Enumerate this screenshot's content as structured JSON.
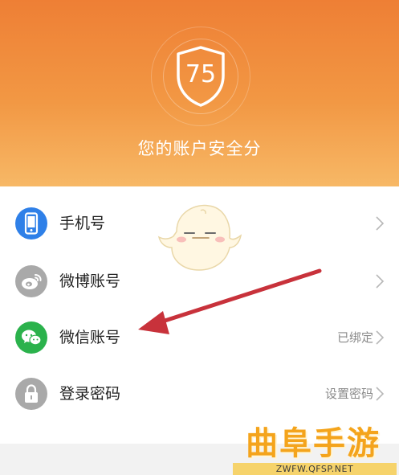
{
  "header": {
    "score": "75",
    "title": "您的账户安全分"
  },
  "accounts": [
    {
      "label": "手机号",
      "value": "",
      "icon": "phone-icon",
      "icon_color": "#2f80e8"
    },
    {
      "label": "微博账号",
      "value": "",
      "icon": "weibo-icon",
      "icon_color": "#a9a9a9"
    },
    {
      "label": "微信账号",
      "value": "已绑定",
      "icon": "wechat-icon",
      "icon_color": "#2bb24c"
    },
    {
      "label": "登录密码",
      "value": "设置密码",
      "icon": "lock-icon",
      "icon_color": "#a9a9a9"
    }
  ],
  "colors": {
    "header_top": "#ee7f35",
    "header_bottom": "#f7b866",
    "arrow": "#c8323b"
  },
  "watermark": {
    "title": "曲阜手游网",
    "url": "ZWFW.QFSP.NET"
  }
}
